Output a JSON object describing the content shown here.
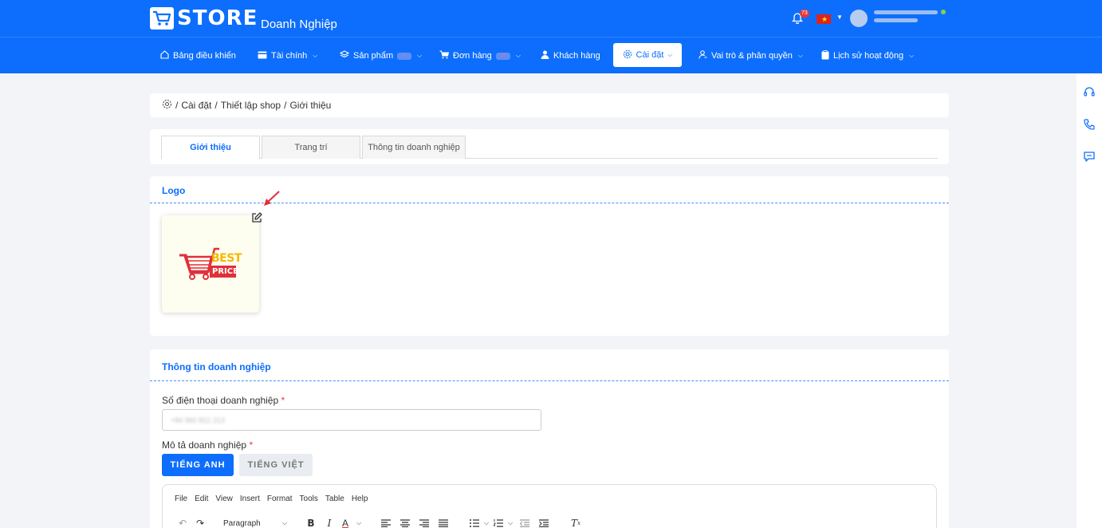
{
  "header": {
    "brand": "STORE",
    "subtitle": "Doanh Nghiệp",
    "notification_count": "73"
  },
  "nav": {
    "items": [
      {
        "label": "Bảng điều khiển",
        "icon": "home-icon"
      },
      {
        "label": "Tài chính",
        "icon": "wallet-icon"
      },
      {
        "label": "Sản phẩm",
        "icon": "layers-icon"
      },
      {
        "label": "Đơn hàng",
        "icon": "cart-icon"
      },
      {
        "label": "Khách hàng",
        "icon": "user-icon"
      },
      {
        "label": "Cài đặt",
        "icon": "gear-icon"
      },
      {
        "label": "Vai trò & phân quyền",
        "icon": "user-role-icon"
      },
      {
        "label": "Lịch sử hoạt động",
        "icon": "clipboard-icon"
      }
    ],
    "products_badge": "0",
    "orders_badge": "10"
  },
  "breadcrumb": {
    "items": [
      "Cài đặt",
      "Thiết lập shop",
      "Giới thiệu"
    ]
  },
  "tabs": [
    {
      "label": "Giới thiệu",
      "active": true
    },
    {
      "label": "Trang trí",
      "active": false
    },
    {
      "label": "Thông tin doanh nghiệp",
      "active": false
    }
  ],
  "logo_section": {
    "title": "Logo",
    "logo_text_top": "BEST",
    "logo_text_bottom": "PRICE"
  },
  "info_section": {
    "title": "Thông tin doanh nghiệp",
    "phone_label": "Số điện thoại doanh nghiệp",
    "phone_value": "+84 960 812 213",
    "description_label": "Mô tả doanh nghiệp",
    "required_mark": "*",
    "lang_en": "TIẾNG ANH",
    "lang_vi": "TIẾNG VIỆT"
  },
  "editor": {
    "menu": [
      "File",
      "Edit",
      "View",
      "Insert",
      "Format",
      "Tools",
      "Table",
      "Help"
    ],
    "block_format": "Paragraph"
  },
  "colors": {
    "primary": "#0d6efd",
    "required": "#e53935",
    "logo_red": "#e0303a",
    "logo_yellow": "#f5b800"
  }
}
